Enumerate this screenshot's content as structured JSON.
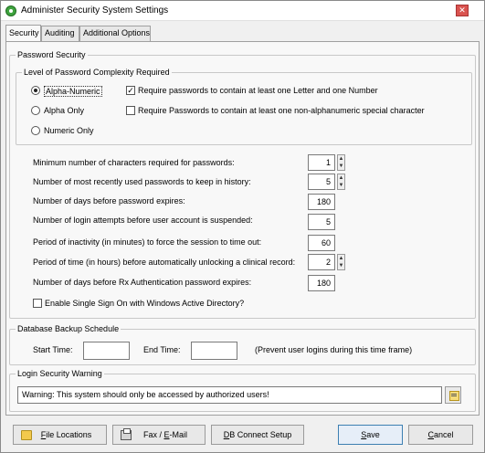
{
  "window": {
    "title": "Administer Security System Settings",
    "close_glyph": "✕"
  },
  "tabs": [
    {
      "label": "Security"
    },
    {
      "label": "Auditing"
    },
    {
      "label": "Additional Options"
    }
  ],
  "password_security": {
    "title": "Password Security",
    "complexity": {
      "title": "Level of Password Complexity Required",
      "options": [
        "Alpha-Numeric",
        "Alpha Only",
        "Numeric Only"
      ],
      "selected": "Alpha-Numeric",
      "require_letter_number": {
        "label": "Require passwords to contain at least one Letter and one Number",
        "checked": true
      },
      "require_special": {
        "label": "Require Passwords to contain at least one non-alphanumeric special character",
        "checked": false
      }
    },
    "settings": [
      {
        "label": "Minimum number of characters required for passwords:",
        "value": "1"
      },
      {
        "label": "Number of most recently used passwords to keep in history:",
        "value": "5"
      },
      {
        "label": "Number of days before password expires:",
        "value": "180"
      },
      {
        "label": "Number of login attempts before user account is suspended:",
        "value": "5"
      },
      {
        "label": "Period of inactivity (in minutes) to force the session to time out:",
        "value": "60"
      },
      {
        "label": "Period of time (in hours) before automatically unlocking a clinical record:",
        "value": "2"
      },
      {
        "label": "Number of days before Rx Authentication password expires:",
        "value": "180"
      }
    ],
    "sso": {
      "label": "Enable Single Sign On with Windows Active Directory?",
      "checked": false
    }
  },
  "backup": {
    "title": "Database Backup Schedule",
    "start_label": "Start Time:",
    "start_value": "",
    "end_label": "End Time:",
    "end_value": "",
    "note": "(Prevent user logins during this time frame)"
  },
  "login_warning": {
    "title": "Login Security Warning",
    "value": "Warning: This system should only be accessed by authorized users!"
  },
  "buttons": {
    "file_locations": {
      "underline": "F",
      "rest": "ile Locations"
    },
    "fax_email": {
      "pre": "Fax / ",
      "underline": "E",
      "rest": "-Mail"
    },
    "db_connect": {
      "underline": "D",
      "rest": "B Connect Setup"
    },
    "save": {
      "underline": "S",
      "rest": "ave"
    },
    "cancel": {
      "underline": "C",
      "rest": "ancel"
    }
  }
}
